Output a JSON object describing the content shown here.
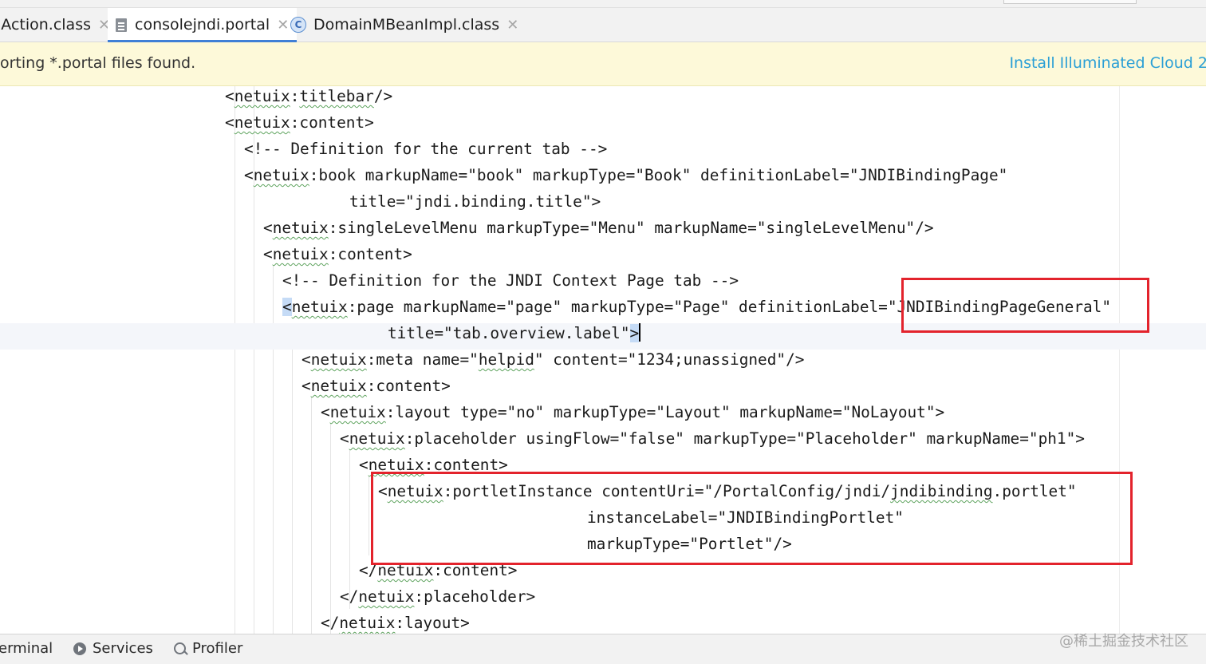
{
  "tabs": [
    {
      "label": "jAction.class",
      "active": false
    },
    {
      "label": "consolejndi.portal",
      "active": true,
      "icon": "file-icon"
    },
    {
      "label": "DomainMBeanImpl.class",
      "active": false,
      "icon": "class-icon",
      "icon_letter": "C"
    }
  ],
  "close_glyph": "✕",
  "notification": {
    "text": "orting *.portal files found.",
    "action": "Install Illuminated Cloud 2"
  },
  "code": {
    "l1": [
      "<",
      "netuix",
      ":",
      "titlebar",
      "/>"
    ],
    "l2": [
      "<",
      "netuix",
      ":content>"
    ],
    "l3": "<!-- Definition for the current tab -->",
    "l4": [
      "<",
      "netuix",
      ":book markupName=\"book\" markupType=\"Book\" definitionLabel=\"JNDIBindingPage\""
    ],
    "l5": "title=\"jndi.binding.title\">",
    "l6": [
      "<",
      "netuix",
      ":singleLevelMenu markupType=\"Menu\" markupName=\"singleLevelMenu\"/>"
    ],
    "l7": [
      "<",
      "netuix",
      ":content>"
    ],
    "l8": "<!-- Definition for the JNDI Context Page tab -->",
    "l9": [
      "<",
      "netuix",
      ":page markupName=\"page\" markupType=\"Page\" definitionLabel=\"JNDIBindingPageGeneral\""
    ],
    "l10": [
      "title=\"tab.overview.label\"",
      ">"
    ],
    "l11": [
      "<",
      "netuix",
      ":meta name=\"",
      "helpid",
      "\" content=\"1234;unassigned\"/>"
    ],
    "l12": [
      "<",
      "netuix",
      ":content>"
    ],
    "l13": [
      "<",
      "netuix",
      ":layout type=\"no\" markupType=\"Layout\" markupName=\"NoLayout\">"
    ],
    "l14": [
      "<",
      "netuix",
      ":placeholder usingFlow=\"false\" markupType=\"Placeholder\" markupName=\"ph1\">"
    ],
    "l15": [
      "<",
      "netuix",
      ":content>"
    ],
    "l16": [
      "<",
      "netuix",
      ":portletInstance contentUri=\"/PortalConfig/jndi/",
      "jndibinding",
      ".portlet\""
    ],
    "l17": "instanceLabel=\"JNDIBindingPortlet\"",
    "l18": "markupType=\"Portlet\"/>",
    "l19": [
      "</",
      "netuix",
      ":content>"
    ],
    "l20": [
      "</",
      "netuix",
      ":placeholder>"
    ],
    "l21": [
      "</",
      "netuix",
      ":layout>"
    ]
  },
  "bottombar": {
    "terminal": "erminal",
    "services": "Services",
    "profiler": "Profiler",
    "watermark": "@稀土掘金技术社区"
  },
  "colors": {
    "annotation_box": "#e3232c",
    "link": "#2a9fd6",
    "active_tab_underline": "#3f7fd6"
  }
}
